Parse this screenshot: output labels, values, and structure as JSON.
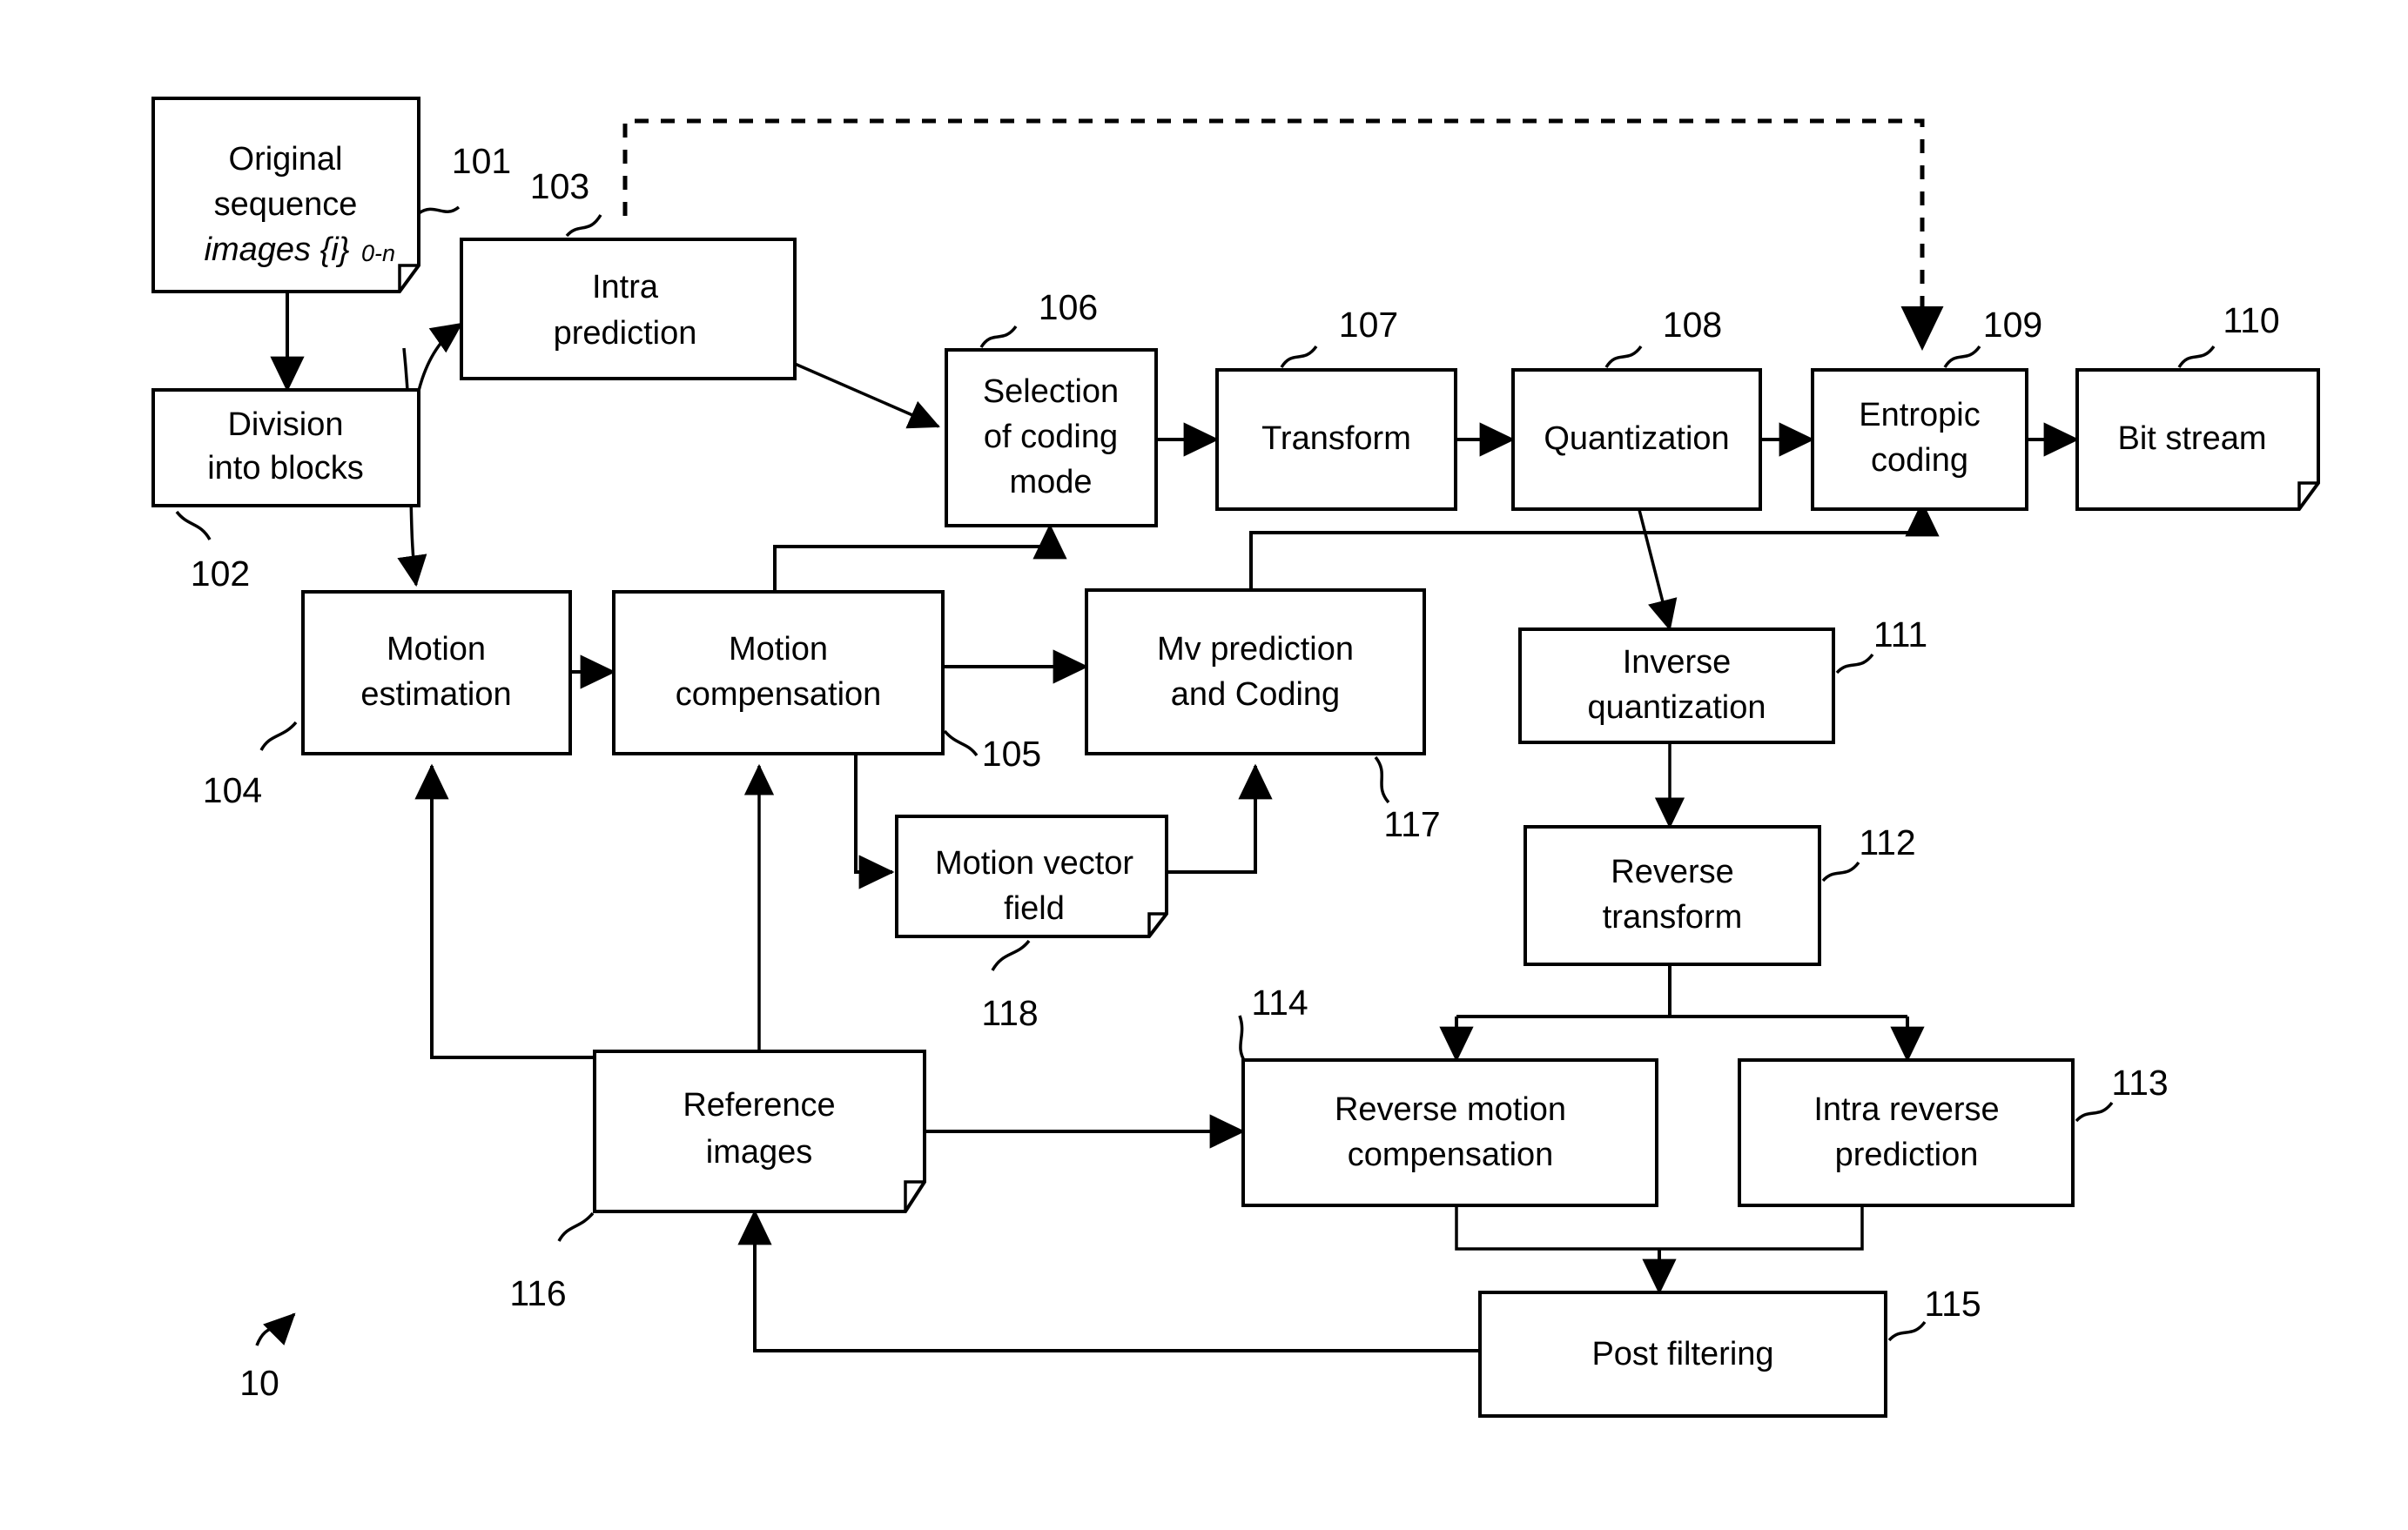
{
  "figure": {
    "id": "10",
    "type": "video-encoder-block-diagram"
  },
  "blocks": {
    "original_sequence": {
      "line1": "Original",
      "line2": "sequence",
      "line3": "images {i}",
      "line3_sub": "0-n",
      "ref": "101",
      "shape": "document"
    },
    "intra_prediction": {
      "line1": "Intra",
      "line2": "prediction",
      "ref": "103",
      "shape": "rect"
    },
    "division_into_blocks": {
      "line1": "Division",
      "line2": "into blocks",
      "ref": "102",
      "shape": "rect"
    },
    "selection_of_coding_mode": {
      "line1": "Selection",
      "line2": "of coding",
      "line3": "mode",
      "ref": "106",
      "shape": "rect"
    },
    "transform": {
      "line1": "Transform",
      "ref": "107",
      "shape": "rect"
    },
    "quantization": {
      "line1": "Quantization",
      "ref": "108",
      "shape": "rect"
    },
    "entropic_coding": {
      "line1": "Entropic",
      "line2": "coding",
      "ref": "109",
      "shape": "rect"
    },
    "bit_stream": {
      "line1": "Bit stream",
      "ref": "110",
      "shape": "document"
    },
    "motion_estimation": {
      "line1": "Motion",
      "line2": "estimation",
      "ref": "104",
      "shape": "rect"
    },
    "motion_compensation": {
      "line1": "Motion",
      "line2": "compensation",
      "ref": "105",
      "shape": "rect"
    },
    "mv_prediction_and_coding": {
      "line1": "Mv prediction",
      "line2": "and Coding",
      "ref": "117",
      "shape": "rect"
    },
    "inverse_quantization": {
      "line1": "Inverse",
      "line2": "quantization",
      "ref": "111",
      "shape": "rect"
    },
    "reverse_transform": {
      "line1": "Reverse",
      "line2": "transform",
      "ref": "112",
      "shape": "rect"
    },
    "motion_vector_field": {
      "line1": "Motion vector",
      "line2": "field",
      "ref": "118",
      "shape": "document"
    },
    "reference_images": {
      "line1": "Reference",
      "line2": "images",
      "ref": "116",
      "shape": "document"
    },
    "reverse_motion_compensation": {
      "line1": "Reverse motion",
      "line2": "compensation",
      "ref": "114",
      "shape": "rect"
    },
    "intra_reverse_prediction": {
      "line1": "Intra reverse",
      "line2": "prediction",
      "ref": "113",
      "shape": "rect"
    },
    "post_filtering": {
      "line1": "Post filtering",
      "ref": "115",
      "shape": "rect"
    }
  },
  "colors": {
    "stroke": "#000000",
    "fill": "#ffffff",
    "background": "#ffffff"
  }
}
